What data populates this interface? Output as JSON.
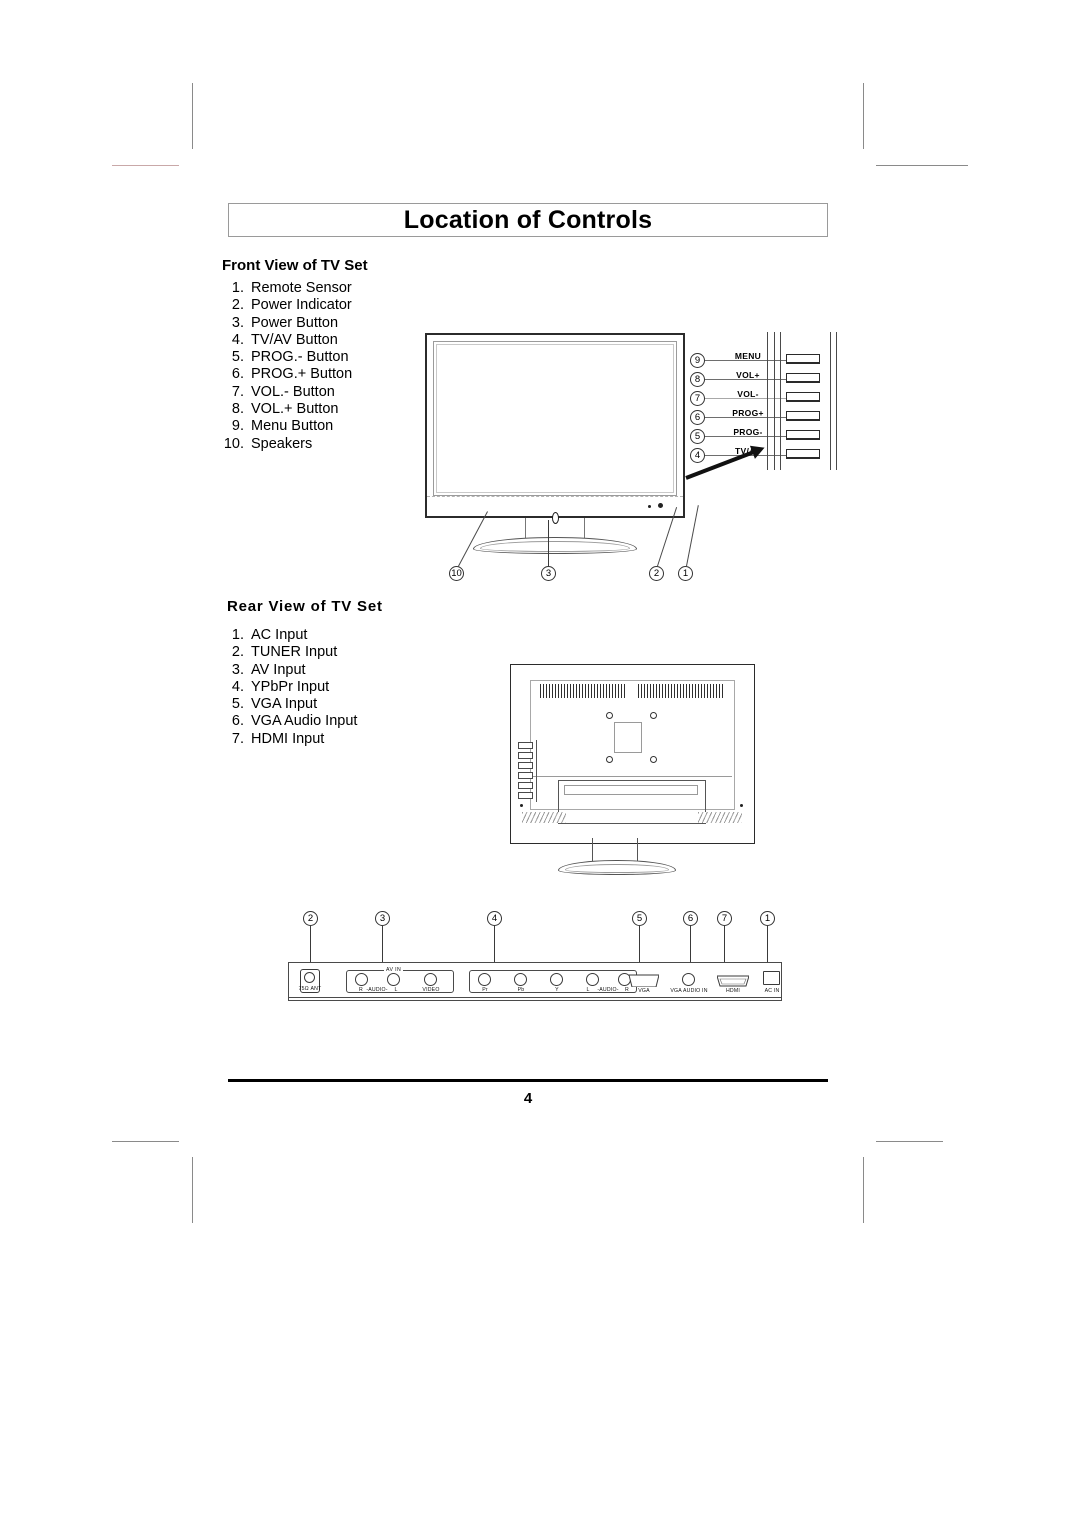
{
  "header": {
    "title": "Location of Controls"
  },
  "front": {
    "heading": "Front View of TV Set",
    "items": [
      {
        "n": "1.",
        "label": "Remote Sensor"
      },
      {
        "n": "2.",
        "label": "Power Indicator"
      },
      {
        "n": "3.",
        "label": "Power Button"
      },
      {
        "n": "4.",
        "label": "TV/AV Button"
      },
      {
        "n": "5.",
        "label": "PROG.- Button"
      },
      {
        "n": "6.",
        "label": "PROG.+ Button"
      },
      {
        "n": "7.",
        "label": "VOL.- Button"
      },
      {
        "n": "8.",
        "label": "VOL.+ Button"
      },
      {
        "n": "9.",
        "label": "Menu Button"
      },
      {
        "n": "10.",
        "label": "Speakers"
      }
    ],
    "callouts": {
      "c1": "1",
      "c2": "2",
      "c3": "3",
      "c10": "10"
    },
    "button_panel": [
      {
        "num": "9",
        "label": "MENU"
      },
      {
        "num": "8",
        "label": "VOL+"
      },
      {
        "num": "7",
        "label": "VOL-"
      },
      {
        "num": "6",
        "label": "PROG+"
      },
      {
        "num": "5",
        "label": "PROG-"
      },
      {
        "num": "4",
        "label": "TV/AV"
      }
    ]
  },
  "rear": {
    "heading": "Rear View of TV Set",
    "items": [
      {
        "n": "1.",
        "label": "AC Input"
      },
      {
        "n": "2.",
        "label": "TUNER  Input"
      },
      {
        "n": "3.",
        "label": "AV Input"
      },
      {
        "n": "4.",
        "label": "YPbPr Input"
      },
      {
        "n": "5.",
        "label": "VGA Input"
      },
      {
        "n": "6.",
        "label": "VGA Audio Input"
      },
      {
        "n": "7.",
        "label": "HDMI Input"
      }
    ],
    "callouts": {
      "c2": "2",
      "c3": "3",
      "c4": "4",
      "c5": "5",
      "c6": "6",
      "c7": "7",
      "c1": "1"
    },
    "connectors": {
      "tuner_label": "75Ω ANT",
      "av_group_label": "AV IN",
      "av_audio_r": "R",
      "av_audio_mid": "-AUDIO-",
      "av_audio_l": "L",
      "video": "VIDEO",
      "pr": "Pr",
      "pb": "Pb",
      "y": "Y",
      "comp_audio_l": "L",
      "comp_audio_mid": "-AUDIO-",
      "comp_audio_r": "R",
      "vga": "VGA",
      "vga_audio_in": "VGA AUDIO IN",
      "hdmi": "HDMI",
      "ac_in": "AC IN"
    }
  },
  "footer": {
    "page_number": "4"
  }
}
